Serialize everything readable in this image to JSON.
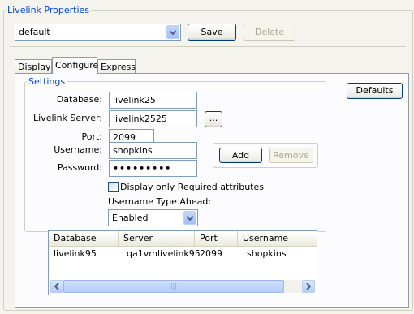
{
  "window": {
    "title": "Livelink Properties"
  },
  "profile": {
    "selected": "default",
    "save_label": "Save",
    "delete_label": "Delete"
  },
  "tabs": [
    {
      "label": "Display",
      "active": false
    },
    {
      "label": "Configure",
      "active": true
    },
    {
      "label": "Express",
      "active": false
    }
  ],
  "defaults_label": "Defaults",
  "settings": {
    "legend": "Settings",
    "database_label": "Database:",
    "database_value": "livelink25",
    "server_label": "Livelink Server:",
    "server_value": "livelink2525",
    "browse_label": "...",
    "port_label": "Port:",
    "port_value": "2099",
    "username_label": "Username:",
    "username_value": "shopkins",
    "password_label": "Password:",
    "password_value": "•••••••••",
    "add_label": "Add",
    "remove_label": "Remove",
    "required_only_label": "Display only Required attributes",
    "required_only_checked": false,
    "type_ahead_label": "Username Type Ahead:",
    "type_ahead_value": "Enabled"
  },
  "connections": {
    "columns": [
      "Database",
      "Server",
      "Port",
      "Username"
    ],
    "rows": [
      [
        "livelink95",
        "qa1vmlivelink95",
        "2099",
        "shopkins"
      ]
    ]
  },
  "colors": {
    "legend": "#0046d5",
    "border": "#7f9db9",
    "tab_highlight": "#e68b2c"
  }
}
